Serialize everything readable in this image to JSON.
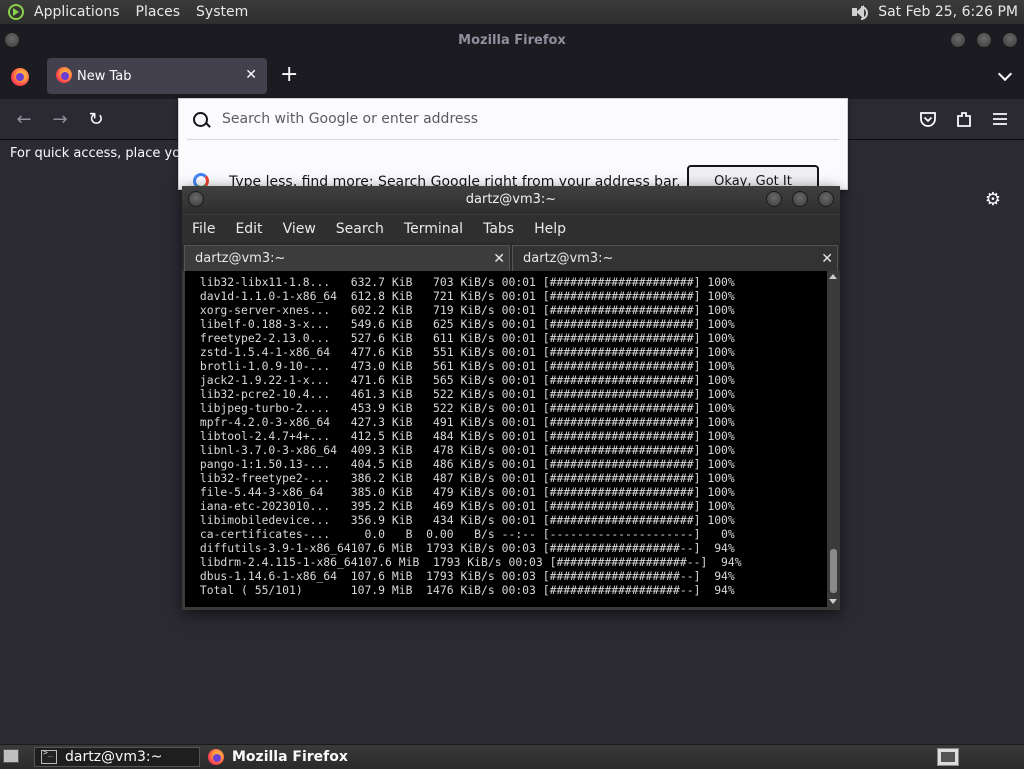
{
  "top_panel": {
    "menus": [
      "Applications",
      "Places",
      "System"
    ],
    "clock": "Sat Feb 25,  6:26 PM"
  },
  "firefox": {
    "window_title": "Mozilla Firefox",
    "tab_label": "New Tab",
    "url_placeholder": "Search with Google or enter address",
    "google_hint": "Type less, find more: Search Google right from your address bar.",
    "okay_button": "Okay, Got It",
    "bookmarks_hint": "For quick access, place your"
  },
  "terminal": {
    "title": "dartz@vm3:~",
    "menus": [
      "File",
      "Edit",
      "View",
      "Search",
      "Terminal",
      "Tabs",
      "Help"
    ],
    "tabs": [
      "dartz@vm3:~",
      "dartz@vm3:~"
    ],
    "lines": [
      " lib32-libx11-1.8...   632.7 KiB   703 KiB/s 00:01 [#####################] 100%",
      " dav1d-1.1.0-1-x86_64  612.8 KiB   721 KiB/s 00:01 [#####################] 100%",
      " xorg-server-xnes...   602.2 KiB   719 KiB/s 00:01 [#####################] 100%",
      " libelf-0.188-3-x...   549.6 KiB   625 KiB/s 00:01 [#####################] 100%",
      " freetype2-2.13.0...   527.6 KiB   611 KiB/s 00:01 [#####################] 100%",
      " zstd-1.5.4-1-x86_64   477.6 KiB   551 KiB/s 00:01 [#####################] 100%",
      " brotli-1.0.9-10-...   473.0 KiB   561 KiB/s 00:01 [#####################] 100%",
      " jack2-1.9.22-1-x...   471.6 KiB   565 KiB/s 00:01 [#####################] 100%",
      " lib32-pcre2-10.4...   461.3 KiB   522 KiB/s 00:01 [#####################] 100%",
      " libjpeg-turbo-2....   453.9 KiB   522 KiB/s 00:01 [#####################] 100%",
      " mpfr-4.2.0-3-x86_64   427.3 KiB   491 KiB/s 00:01 [#####################] 100%",
      " libtool-2.4.7+4+...   412.5 KiB   484 KiB/s 00:01 [#####################] 100%",
      " libnl-3.7.0-3-x86_64  409.3 KiB   478 KiB/s 00:01 [#####################] 100%",
      " pango-1:1.50.13-...   404.5 KiB   486 KiB/s 00:01 [#####################] 100%",
      " lib32-freetype2-...   386.2 KiB   487 KiB/s 00:01 [#####################] 100%",
      " file-5.44-3-x86_64    385.0 KiB   479 KiB/s 00:01 [#####################] 100%",
      " iana-etc-2023010...   395.2 KiB   469 KiB/s 00:01 [#####################] 100%",
      " libimobiledevice...   356.9 KiB   434 KiB/s 00:01 [#####################] 100%",
      " ca-certificates-...     0.0   B  0.00   B/s --:-- [---------------------]   0%",
      " diffutils-3.9-1-x86_64107.6 MiB  1793 KiB/s 00:03 [###################--]  94%",
      " libdrm-2.4.115-1-x86_64107.6 MiB  1793 KiB/s 00:03 [###################--]  94%",
      " dbus-1.14.6-1-x86_64  107.6 MiB  1793 KiB/s 00:03 [###################--]  94%",
      " Total ( 55/101)       107.9 MiB  1476 KiB/s 00:03 [###################--]  94%"
    ]
  },
  "taskbar": {
    "items": [
      "dartz@vm3:~",
      "Mozilla Firefox"
    ]
  }
}
